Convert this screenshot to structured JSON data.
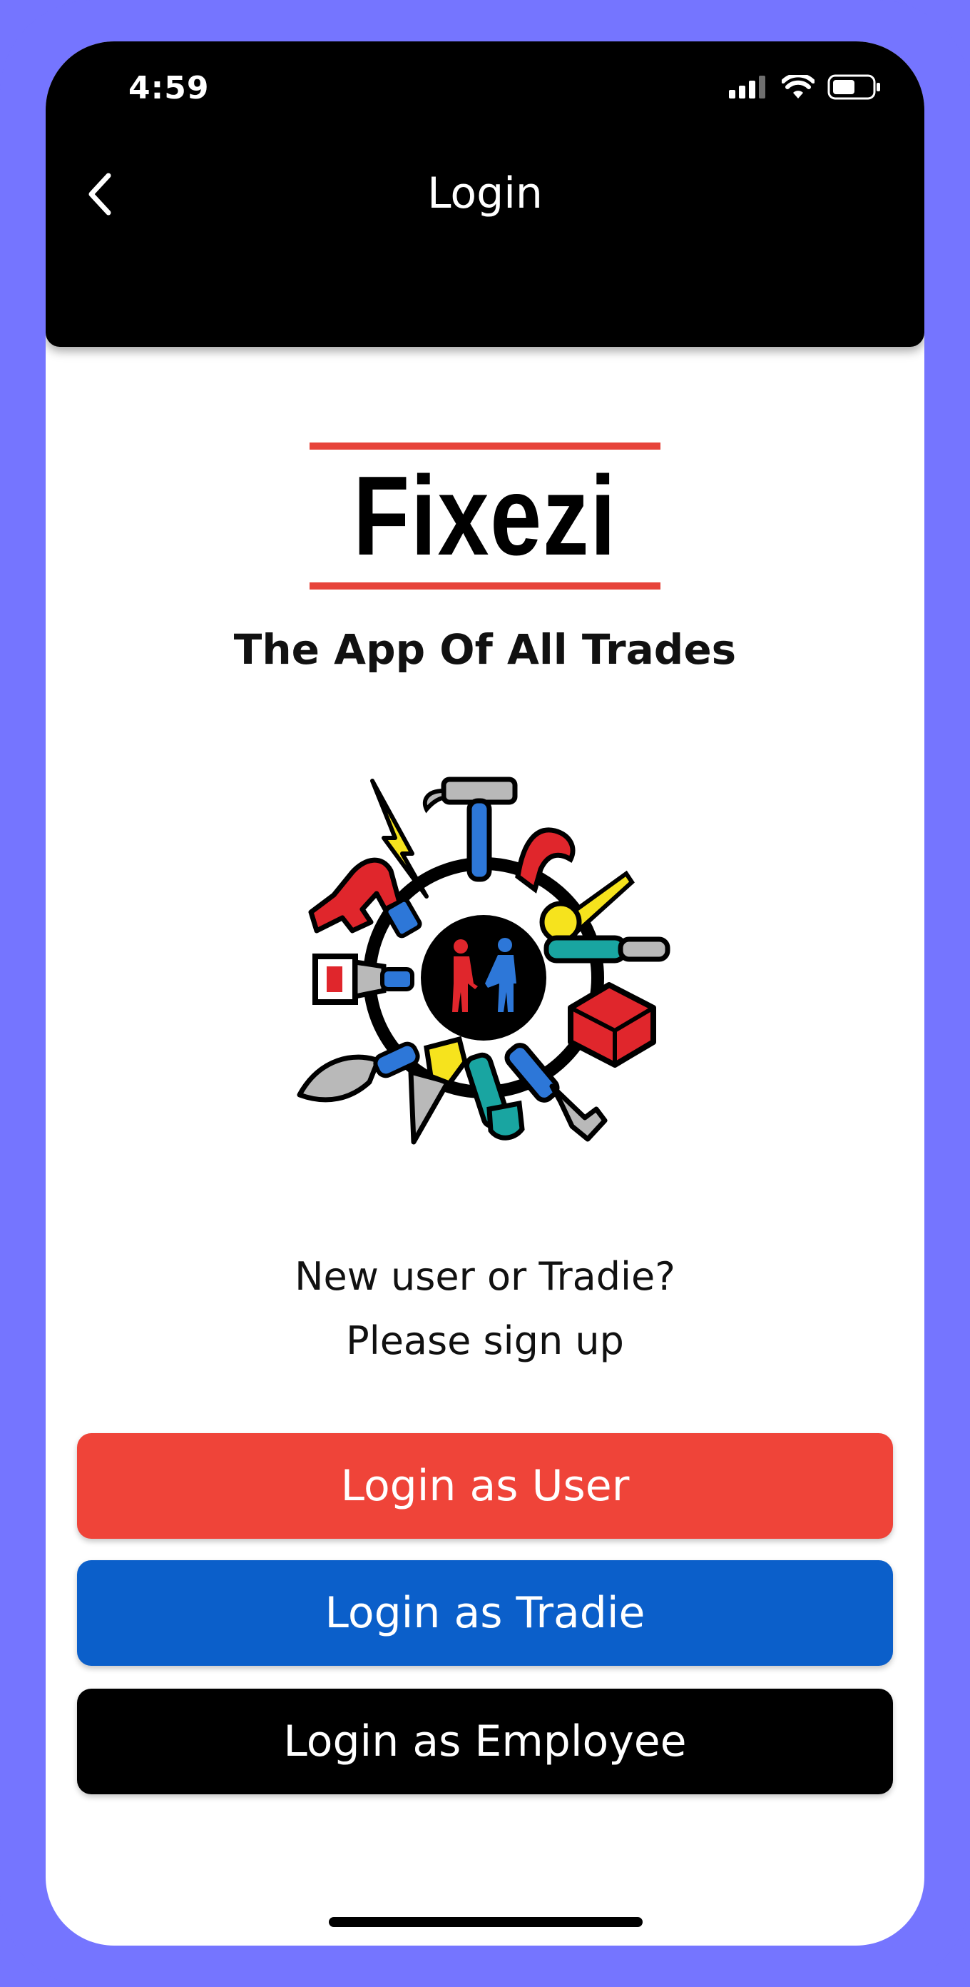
{
  "status_bar": {
    "time": "4:59",
    "signal_icon": "cellular-signal-icon",
    "wifi_icon": "wifi-icon",
    "battery_icon": "battery-icon"
  },
  "header": {
    "title": "Login",
    "back_icon": "chevron-left-icon"
  },
  "brand": {
    "logo_text": "Fixezi",
    "tagline": "The App Of All Trades",
    "illustration": "tools-handshake-illustration"
  },
  "signup": {
    "line1": "New user or Tradie?",
    "line2": "Please sign up"
  },
  "buttons": {
    "user": "Login as User",
    "tradie": "Login as Tradie",
    "employee": "Login as Employee"
  },
  "colors": {
    "frame": "#7575ff",
    "header_bg": "#000000",
    "accent_red": "#ef4439",
    "accent_blue": "#0b5fca",
    "employee_black": "#000000"
  }
}
